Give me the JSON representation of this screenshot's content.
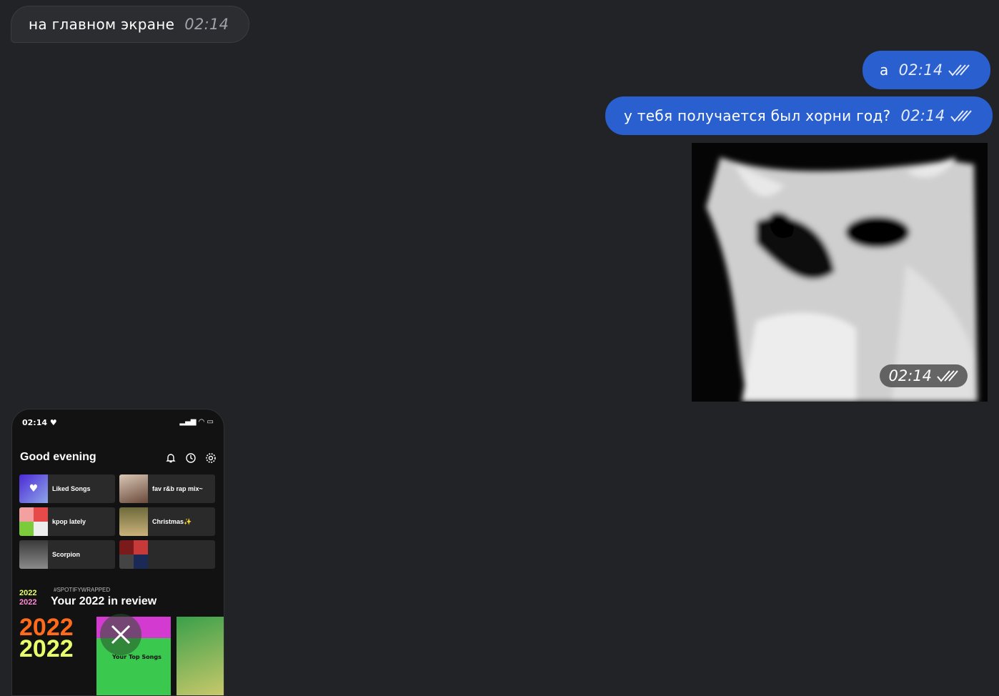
{
  "messages": {
    "m1": {
      "text": "на главном экране",
      "time": "02:14"
    },
    "m2": {
      "text": "а",
      "time": "02:14"
    },
    "m3": {
      "text": "у тебя получается был хорни год?",
      "time": "02:14"
    },
    "photo": {
      "time": "02:14"
    }
  },
  "phone": {
    "status_time": "02:14",
    "greeting": "Good evening",
    "tiles": [
      {
        "label": "Liked Songs"
      },
      {
        "label": "fav r&b rap mix~"
      },
      {
        "label": "kpop lately"
      },
      {
        "label": "Christmas✨"
      },
      {
        "label": "Scorpion"
      },
      {
        "label": ""
      }
    ],
    "wrapped_tag": "#SPOTIFYWRAPPED",
    "wrapped_title": "Your 2022 in review",
    "card_year": "2022",
    "card_label": "Your Top Songs"
  },
  "colors": {
    "background": "#212327",
    "outgoing": "#2a5fd0",
    "incoming": "#2b2d31"
  }
}
